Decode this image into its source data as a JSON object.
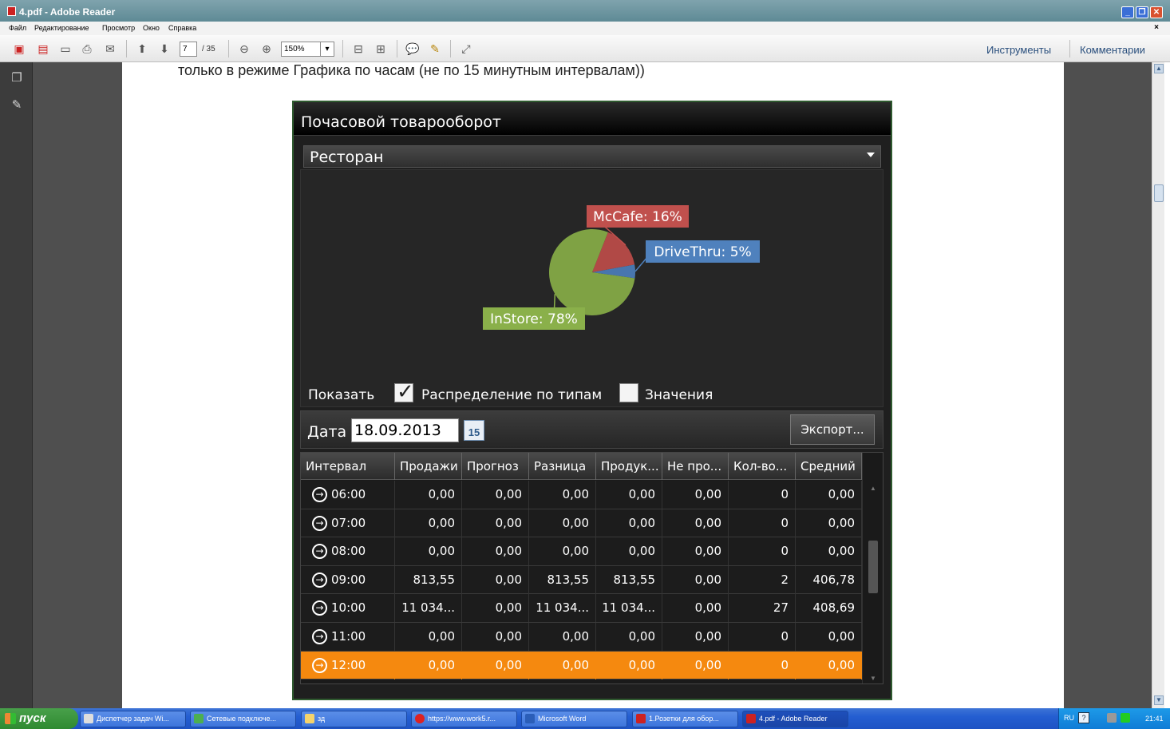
{
  "window": {
    "title": "4.pdf - Adobe Reader",
    "controls": [
      "minimize-icon",
      "restore-icon",
      "close-icon"
    ]
  },
  "menu": {
    "items": [
      "Файл",
      "Редактирование",
      "Просмотр",
      "Окно",
      "Справка"
    ],
    "close": "×"
  },
  "toolbar": {
    "page_current": "7",
    "page_total": "/ 35",
    "zoom": "150%",
    "tools": "Инструменты",
    "comments": "Комментарии"
  },
  "document": {
    "text": "только в режиме Графика по часам (не по 15 минутным интервалам))"
  },
  "app": {
    "title": "Почасовой товарооборот",
    "store_select": "Ресторан",
    "chart_data": {
      "type": "pie",
      "slices": [
        {
          "label": "InStore",
          "value": 78,
          "color": "#8ab04a",
          "tag": "InStore: 78%"
        },
        {
          "label": "McCafe",
          "value": 16,
          "color": "#c0504d",
          "tag": "McCafe: 16%"
        },
        {
          "label": "DriveThru",
          "value": 5,
          "color": "#4f81bd",
          "tag": "DriveThru: 5%"
        }
      ]
    },
    "show_label": "Показать",
    "check_distribution": {
      "label": "Распределение по типам",
      "checked": true
    },
    "check_values": {
      "label": "Значения",
      "checked": false
    },
    "date_label": "Дата",
    "date_value": "18.09.2013",
    "calendar_day": "15",
    "export_label": "Экспорт...",
    "grid": {
      "columns": [
        "Интервал",
        "Продажи",
        "Прогноз",
        "Разница",
        "Продук...",
        "Не про...",
        "Кол-во...",
        "Средний"
      ],
      "rows": [
        [
          "06:00",
          "0,00",
          "0,00",
          "0,00",
          "0,00",
          "0,00",
          "0",
          "0,00"
        ],
        [
          "07:00",
          "0,00",
          "0,00",
          "0,00",
          "0,00",
          "0,00",
          "0",
          "0,00"
        ],
        [
          "08:00",
          "0,00",
          "0,00",
          "0,00",
          "0,00",
          "0,00",
          "0",
          "0,00"
        ],
        [
          "09:00",
          "813,55",
          "0,00",
          "813,55",
          "813,55",
          "0,00",
          "2",
          "406,78"
        ],
        [
          "10:00",
          "11 034...",
          "0,00",
          "11 034...",
          "11 034...",
          "0,00",
          "27",
          "408,69"
        ],
        [
          "11:00",
          "0,00",
          "0,00",
          "0,00",
          "0,00",
          "0,00",
          "0",
          "0,00"
        ],
        [
          "12:00",
          "0,00",
          "0,00",
          "0,00",
          "0,00",
          "0,00",
          "0",
          "0,00"
        ]
      ],
      "selected_row": 6
    }
  },
  "taskbar": {
    "start": "пуск",
    "tasks": [
      {
        "label": "Диспетчер задач Wi...",
        "icon": "monitor-icon",
        "active": false
      },
      {
        "label": "Сетевые подключе...",
        "icon": "network-icon",
        "active": false
      },
      {
        "label": "зд",
        "icon": "folder-icon",
        "active": false
      },
      {
        "label": "https://www.work5.r...",
        "icon": "opera-icon",
        "active": false
      },
      {
        "label": "Microsoft Word",
        "icon": "word-icon",
        "active": false
      },
      {
        "label": "1.Розетки для обор...",
        "icon": "pdf-icon",
        "active": false
      },
      {
        "label": "4.pdf - Adobe Reader",
        "icon": "pdf-icon",
        "active": true
      }
    ],
    "lang": "RU",
    "time": "21:41"
  }
}
